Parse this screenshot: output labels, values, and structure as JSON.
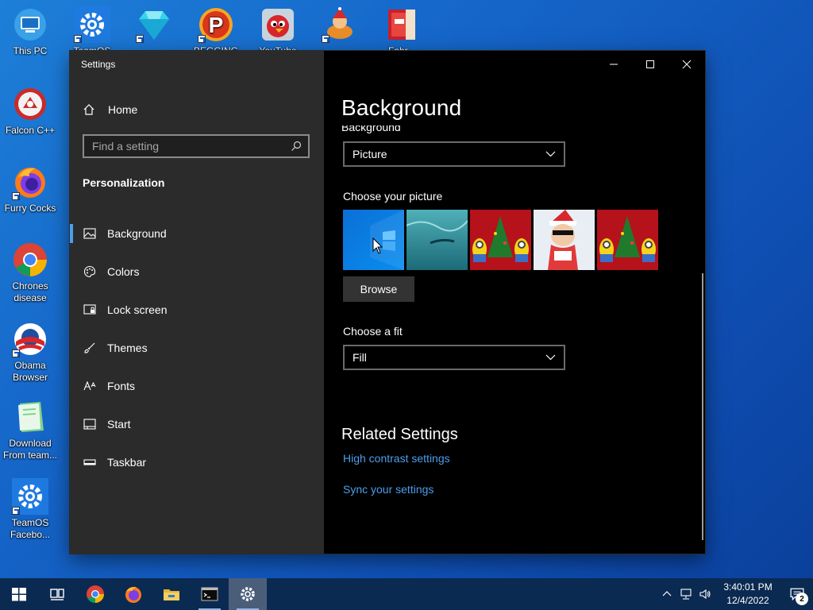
{
  "desktop": {
    "icons": [
      {
        "label": "This PC",
        "icon": "computer-icon"
      },
      {
        "label": "TeamOS",
        "icon": "gear-icon"
      },
      {
        "label": "...",
        "icon": "diamond-icon"
      },
      {
        "label": "BEGGING LOL",
        "icon": "p-logo-icon"
      },
      {
        "label": "YouTube",
        "icon": "angry-bird-icon"
      },
      {
        "label": "...",
        "icon": "app-icon"
      },
      {
        "label": "Fahr...",
        "icon": "book-icon"
      },
      {
        "label": "Falcon C++",
        "icon": "falcon-icon"
      },
      {
        "label": "Furry Cocks",
        "icon": "firefox-icon"
      },
      {
        "label": "Chrones disease",
        "icon": "chrome-icon"
      },
      {
        "label": "Obama Browser",
        "icon": "obama-icon"
      },
      {
        "label": "Download From team...",
        "icon": "notepad-icon"
      },
      {
        "label": "TeamOS Facebo...",
        "icon": "gear-icon"
      }
    ]
  },
  "window": {
    "title": "Settings",
    "controls": {
      "minimize": "minimize-icon",
      "maximize": "maximize-icon",
      "close": "close-icon"
    }
  },
  "sidebar": {
    "home_label": "Home",
    "search_placeholder": "Find a setting",
    "section_title": "Personalization",
    "items": [
      {
        "label": "Background",
        "icon": "picture-icon",
        "active": true
      },
      {
        "label": "Colors",
        "icon": "palette-icon",
        "active": false
      },
      {
        "label": "Lock screen",
        "icon": "lock-screen-icon",
        "active": false
      },
      {
        "label": "Themes",
        "icon": "brush-icon",
        "active": false
      },
      {
        "label": "Fonts",
        "icon": "font-icon",
        "active": false
      },
      {
        "label": "Start",
        "icon": "start-icon",
        "active": false
      },
      {
        "label": "Taskbar",
        "icon": "taskbar-icon",
        "active": false
      }
    ]
  },
  "main": {
    "title": "Background",
    "clipped_label": "Background",
    "background_dropdown": "Picture",
    "choose_picture_label": "Choose your picture",
    "thumbnails": [
      "windows-blue",
      "underwater",
      "minions-christmas",
      "santa-sunglasses",
      "minions-christmas"
    ],
    "browse_label": "Browse",
    "choose_fit_label": "Choose a fit",
    "fit_dropdown": "Fill",
    "related_title": "Related Settings",
    "links": {
      "high_contrast": "High contrast settings",
      "sync": "Sync your settings"
    }
  },
  "taskbar": {
    "apps": [
      "start-icon",
      "task-view-icon",
      "chrome-icon",
      "firefox-icon",
      "file-explorer-icon",
      "terminal-icon",
      "settings-icon"
    ],
    "time": "3:40:01 PM",
    "date": "12/4/2022",
    "notification_count": "2"
  },
  "colors": {
    "accent": "#4c9fea",
    "sidebar_bg": "#2b2b2b",
    "main_bg": "#000000",
    "taskbar_bg": "#0b2a52"
  }
}
